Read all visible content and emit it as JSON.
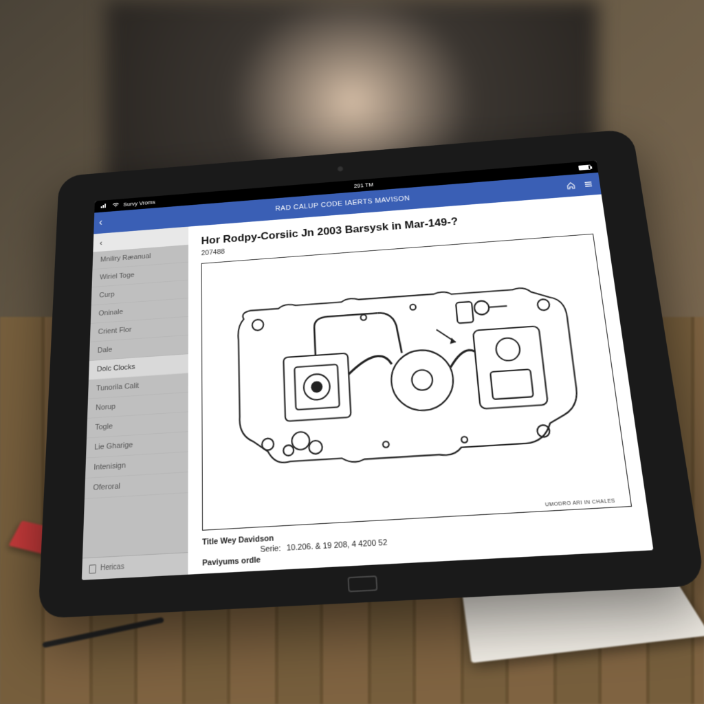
{
  "statusbar": {
    "carrier": "Survy Vroms",
    "time": "291 TM",
    "battery_pct": 85
  },
  "header": {
    "back_label": "",
    "title": "RAD CALUP CODE IAERTS MAVISON",
    "home_icon": "home-icon",
    "menu_icon": "menu-icon"
  },
  "sidebar": {
    "header_label": "",
    "items": [
      {
        "label": "Mniliry Ræanual",
        "selected": false
      },
      {
        "label": "Wiriel Toge",
        "selected": false
      },
      {
        "label": "Curp",
        "selected": false
      },
      {
        "label": "Oninale",
        "selected": false
      },
      {
        "label": "Crient Flor",
        "selected": false
      },
      {
        "label": "Dale",
        "selected": false
      },
      {
        "label": "Dolc Clocks",
        "selected": true
      },
      {
        "label": "Tunorila Calit",
        "selected": false
      },
      {
        "label": "Norup",
        "selected": false
      },
      {
        "label": "Togle",
        "selected": false
      },
      {
        "label": "Lie Gharige",
        "selected": false
      },
      {
        "label": "Intenisign",
        "selected": false
      },
      {
        "label": "Oferoral",
        "selected": false
      }
    ],
    "footer_label": "Hericas"
  },
  "main": {
    "title": "Hor Rodpy-Corsiic Jn 2003 Barsysk in Mar-149-?",
    "subtitle": "207488",
    "diagram_caption": "UMODRO ARI IN CHALES",
    "meta": {
      "title_label": "Title Wey Davidson",
      "serie_label": "Serie:",
      "serie_value": "10.206. & 19 208, 4 4200 52",
      "partnum_label": "Paviyums ordle"
    }
  }
}
